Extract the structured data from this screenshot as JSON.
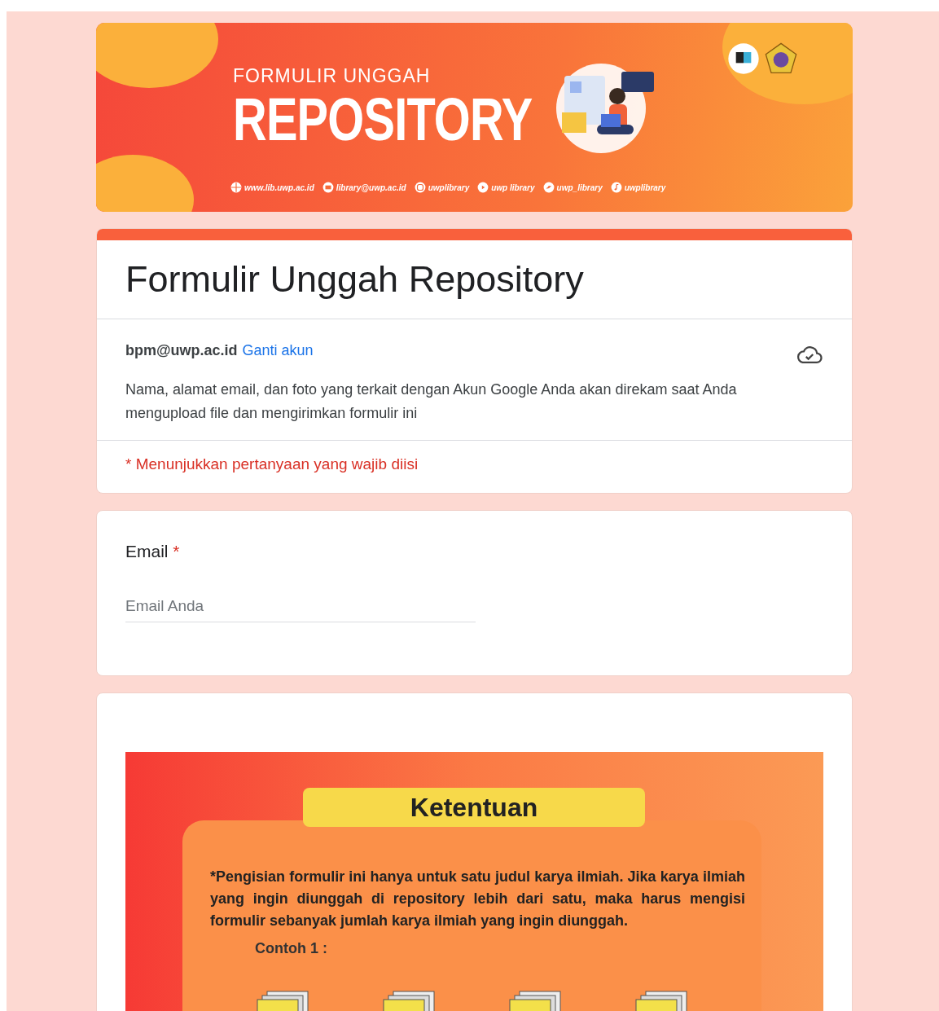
{
  "banner": {
    "subtitle": "FORMULIR UNGGAH",
    "title": "REPOSITORY",
    "links": [
      {
        "kind": "web",
        "text": "www.lib.uwp.ac.id"
      },
      {
        "kind": "mail",
        "text": "library@uwp.ac.id"
      },
      {
        "kind": "instagram",
        "text": "uwplibrary"
      },
      {
        "kind": "youtube",
        "text": "uwp library"
      },
      {
        "kind": "twitter",
        "text": "uwp_library"
      },
      {
        "kind": "tiktok",
        "text": "uwplibrary"
      }
    ]
  },
  "form": {
    "title": "Formulir Unggah Repository",
    "account": "bpm@uwp.ac.id",
    "switch_account": "Ganti akun",
    "notice": "Nama, alamat email, dan foto yang terkait dengan Akun Google Anda akan direkam saat Anda mengupload file dan mengirimkan formulir ini",
    "required_note": "* Menunjukkan pertanyaan yang wajib diisi"
  },
  "email_question": {
    "label": "Email",
    "required_mark": "*",
    "placeholder": "Email Anda"
  },
  "rules_image": {
    "heading": "Ketentuan",
    "text": "*Pengisian formulir ini hanya untuk satu judul karya ilmiah. Jika karya ilmiah yang ingin diunggah di repository lebih dari satu, maka harus mengisi formulir sebanyak jumlah karya ilmiah yang ingin diunggah.",
    "example": "Contoh 1 :"
  }
}
